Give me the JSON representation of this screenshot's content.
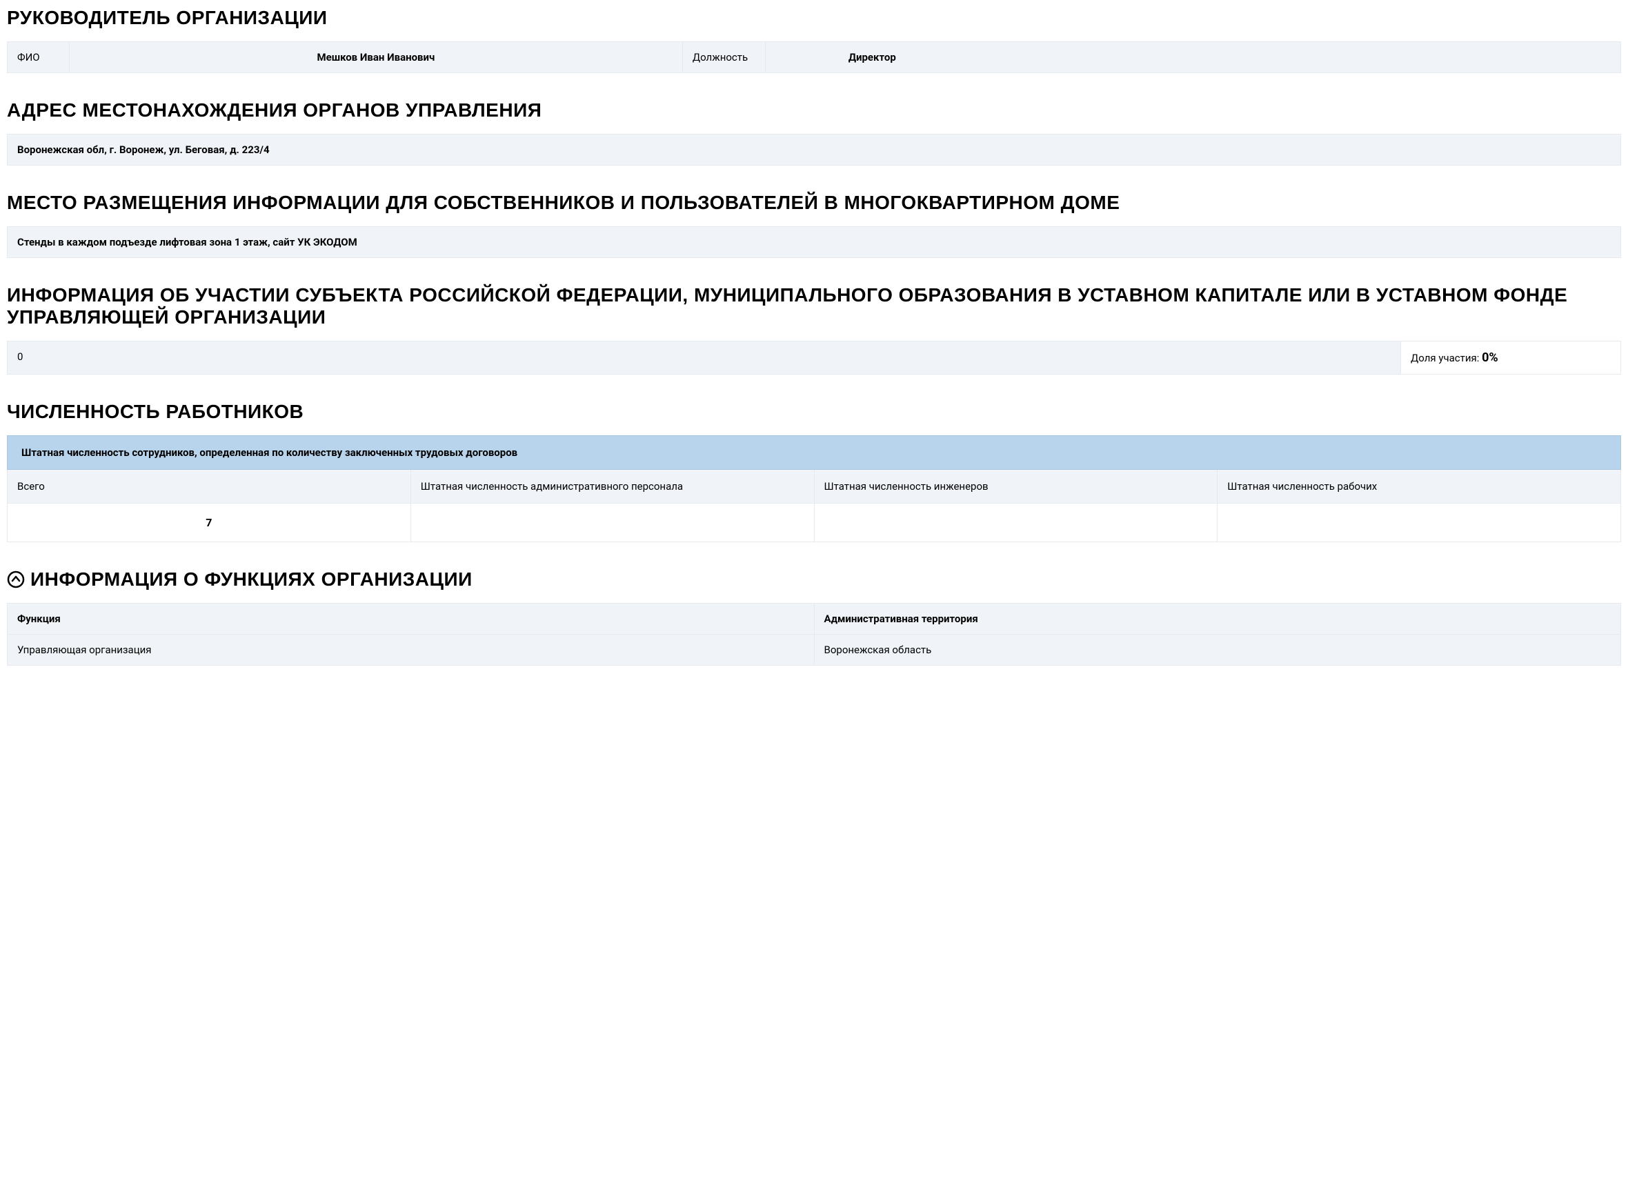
{
  "sections": {
    "leader": {
      "title": "РУКОВОДИТЕЛЬ ОРГАНИЗАЦИИ",
      "fio_label": "ФИО",
      "fio_value": "Мешков Иван Иванович",
      "position_label": "Должность",
      "position_value": "Директор"
    },
    "address": {
      "title": "АДРЕС МЕСТОНАХОЖДЕНИЯ ОРГАНОВ УПРАВЛЕНИЯ",
      "value": "Воронежская обл, г. Воронеж, ул. Беговая, д. 223/4"
    },
    "info_placement": {
      "title": "МЕСТО РАЗМЕЩЕНИЯ ИНФОРМАЦИИ ДЛЯ СОБСТВЕННИКОВ И ПОЛЬЗОВАТЕЛЕЙ В МНОГОКВАРТИРНОМ ДОМЕ",
      "value": "Стенды в каждом подъезде лифтовая зона 1 этаж, сайт УК ЭКОДОМ"
    },
    "participation": {
      "title": "ИНФОРМАЦИЯ ОБ УЧАСТИИ СУБЪЕКТА РОССИЙСКОЙ ФЕДЕРАЦИИ, МУНИЦИПАЛЬНОГО ОБРАЗОВАНИЯ В УСТАВНОМ КАПИТАЛЕ ИЛИ В УСТАВНОМ ФОНДЕ УПРАВЛЯЮЩЕЙ ОРГАНИЗАЦИИ",
      "value": "0",
      "share_label": "Доля участия: ",
      "share_value": "0%"
    },
    "staff": {
      "title": "ЧИСЛЕННОСТЬ РАБОТНИКОВ",
      "header": "Штатная численность сотрудников, определенная по количеству заключенных трудовых договоров",
      "cols": {
        "c1": "Всего",
        "c2": "Штатная численность административного персонала",
        "c3": "Штатная численность инженеров",
        "c4": "Штатная численность рабочих"
      },
      "vals": {
        "v1": "7",
        "v2": "",
        "v3": "",
        "v4": ""
      }
    },
    "functions": {
      "title": "ИНФОРМАЦИЯ О ФУНКЦИЯХ ОРГАНИЗАЦИИ",
      "col1": "Функция",
      "col2": "Административная территория",
      "row1_c1": "Управляющая организация",
      "row1_c2": "Воронежская область"
    }
  }
}
